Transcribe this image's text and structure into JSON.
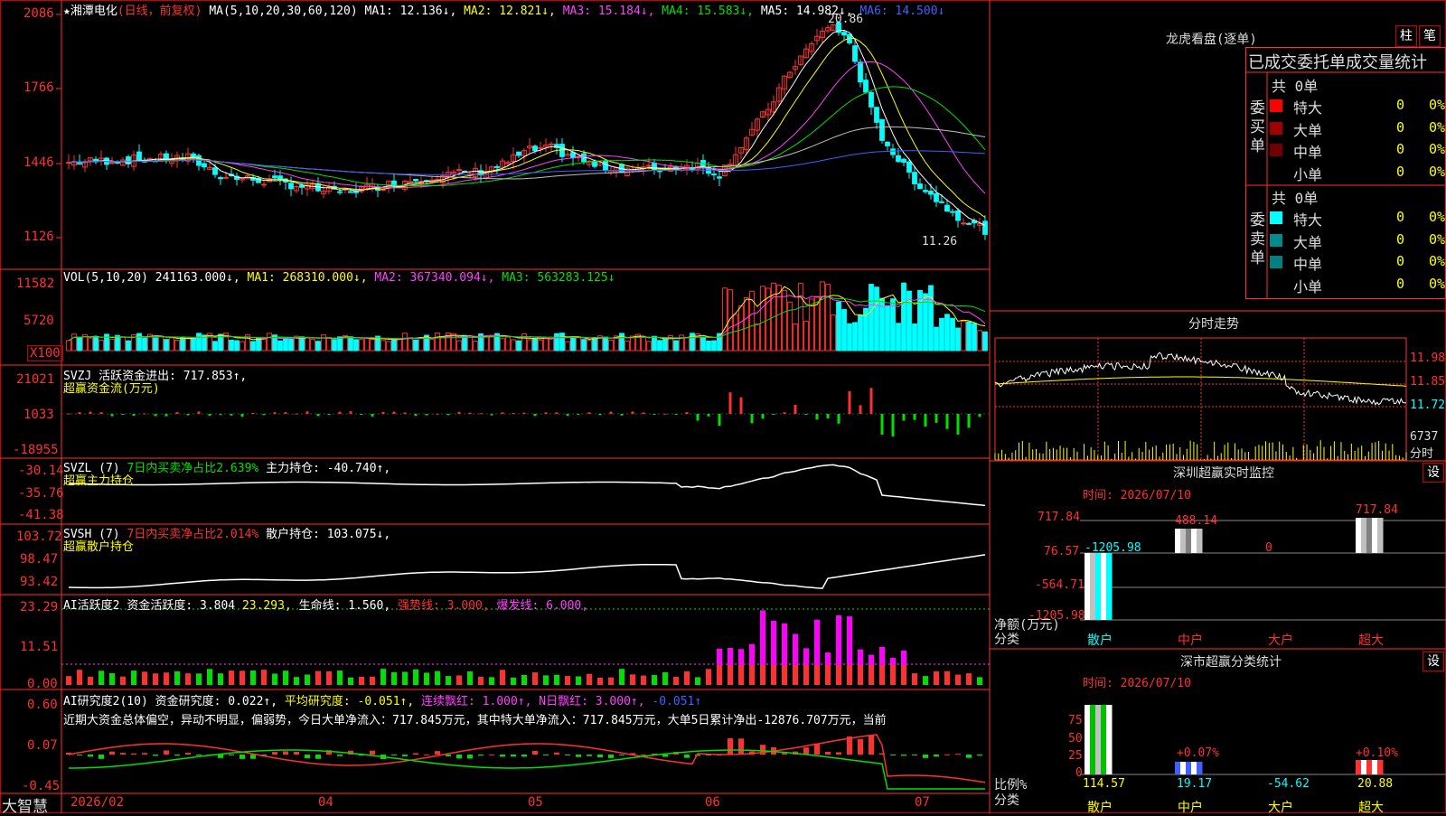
{
  "header": {
    "star": "★",
    "stock_name": "湘潭电化",
    "period": "(日线，前复权)",
    "ma_label": "MA(5,10,20,30,60,120)",
    "ma1": "MA1: 12.136↓,",
    "ma2": "MA2: 12.821↓,",
    "ma3": "MA3: 15.184↓,",
    "ma4": "MA4: 15.583↓,",
    "ma5": "MA5: 14.982↓,",
    "ma6": "MA6: 14.500↓"
  },
  "price_axis": [
    "2086",
    "1766",
    "1446",
    "1126"
  ],
  "high_label": "20.86",
  "low_label": "11.26",
  "vol_header": {
    "label": "VOL(5,10,20)",
    "value": "241163.000↓,",
    "ma1": "MA1: 268310.000↓,",
    "ma2": "MA2: 367340.094↓,",
    "ma3": "MA3: 563283.125↓"
  },
  "vol_axis": [
    "11582",
    "5720",
    "X100"
  ],
  "svzj": {
    "label": "SVZJ  活跃资金进出: 717.853↑,",
    "sub": "超赢资金流(万元)",
    "axis": [
      "21021",
      "1033",
      "-18955"
    ]
  },
  "svzl": {
    "label": "SVZL (7)",
    "ratio": "7日内买卖净占比2.639%",
    "hold": "主力持仓: -40.740↑,",
    "sub": "超赢主力持仓",
    "axis": [
      "-30.14",
      "-35.76",
      "-41.38"
    ]
  },
  "svsh": {
    "label": "SVSH (7)",
    "ratio": "7日内买卖净占比2.014%",
    "hold": "散户持仓: 103.075↓,",
    "sub": "超赢散户持仓",
    "axis": [
      "103.72",
      "98.47",
      "93.42"
    ]
  },
  "ai_active": {
    "label": "AI活跃度2",
    "v1": "资金活跃度: 3.804",
    "v2": "23.293,",
    "v3": "生命线: 1.560,",
    "v4": "强势线: 3.000,",
    "v5": "爆发线: 6.000,",
    "axis": [
      "23.29",
      "11.51",
      "0.00"
    ]
  },
  "ai_research": {
    "label": "AI研究度2(10)",
    "v1": "资金研究度: 0.022↑,",
    "v2": "平均研究度: -0.051↑,",
    "v3": "连续飘红: 1.000↑,",
    "v4": "N日飘红: 3.000↑,",
    "v5": "-0.051↑",
    "summary": "近期大资金总体偏空，异动不明显，偏弱势，今日大单净流入：717.845万元，其中特大单净流入：717.845万元，大单5日累计净出-12876.707万元，当前",
    "axis": [
      "0.60",
      "0.07",
      "-0.45"
    ]
  },
  "date_axis": [
    "2026/02",
    "04",
    "05",
    "06",
    "07"
  ],
  "brand": "大智慧",
  "right": {
    "dragon_title": "龙虎看盘(逐单)",
    "btn_zhu": "柱",
    "btn_bi": "笔",
    "order_title": "已成交委托单成交量统计",
    "buy_total": "共 0单",
    "buy_side": "委买单",
    "sell_total": "共 0单",
    "sell_side": "委卖单",
    "buy_rows": [
      {
        "label": "特大",
        "count": "0",
        "pct": "0%",
        "color": "#ff0000"
      },
      {
        "label": "大单",
        "count": "0",
        "pct": "0%",
        "color": "#a00000"
      },
      {
        "label": "中单",
        "count": "0",
        "pct": "0%",
        "color": "#700000"
      },
      {
        "label": "小单",
        "count": "0",
        "pct": "0%",
        "color": ""
      }
    ],
    "sell_rows": [
      {
        "label": "特大",
        "count": "0",
        "pct": "0%",
        "color": "#00ffff"
      },
      {
        "label": "大单",
        "count": "0",
        "pct": "0%",
        "color": "#008c8c"
      },
      {
        "label": "中单",
        "count": "0",
        "pct": "0%",
        "color": "#008080"
      },
      {
        "label": "小单",
        "count": "0",
        "pct": "0%",
        "color": ""
      }
    ],
    "intraday_title": "分时走势",
    "intraday_axis": [
      "11.98",
      "11.85",
      "11.72",
      "6737"
    ],
    "intraday_unit": "分时",
    "monitor_title": "深圳超赢实时监控",
    "monitor_btn": "设",
    "monitor_time": "时间: 2026/07/10",
    "monitor_axis": [
      "717.84",
      "76.57",
      "-564.71",
      "-1205.98"
    ],
    "monitor_vals": [
      "-1205.98",
      "488.14",
      "0",
      "717.84"
    ],
    "monitor_ylabel": "净额(万元)",
    "monitor_xlabel": "分类",
    "monitor_cats": [
      "散户",
      "中户",
      "大户",
      "超大"
    ],
    "stats_title": "深市超赢分类统计",
    "stats_btn": "设",
    "stats_time": "时间: 2026/07/10",
    "stats_axis": [
      "75",
      "50",
      "25",
      "0"
    ],
    "stats_pct": [
      "+0.07%",
      "+0.10%"
    ],
    "stats_vals": [
      "114.57",
      "19.17",
      "-54.62",
      "20.88"
    ],
    "stats_ylabel": "比例%",
    "stats_xlabel": "分类",
    "stats_cats": [
      "散户",
      "中户",
      "大户",
      "超大"
    ]
  },
  "chart_data": {
    "type": "candlestick",
    "title": "湘潭电化 (日线，前复权)",
    "y_ticks": [
      20.86,
      17.66,
      14.46,
      11.26
    ],
    "x_ticks": [
      "2026/02",
      "04",
      "05",
      "06",
      "07"
    ],
    "high": 20.86,
    "low": 11.26,
    "last_close": 11.6,
    "ma_last": {
      "MA1": 12.136,
      "MA2": 12.821,
      "MA3": 15.184,
      "MA4": 15.583,
      "MA5": 14.982,
      "MA6": 14.5
    },
    "volume_last": 241163.0,
    "volume_ma": {
      "MA1": 268310.0,
      "MA2": 367340.094,
      "MA3": 563283.125
    }
  }
}
